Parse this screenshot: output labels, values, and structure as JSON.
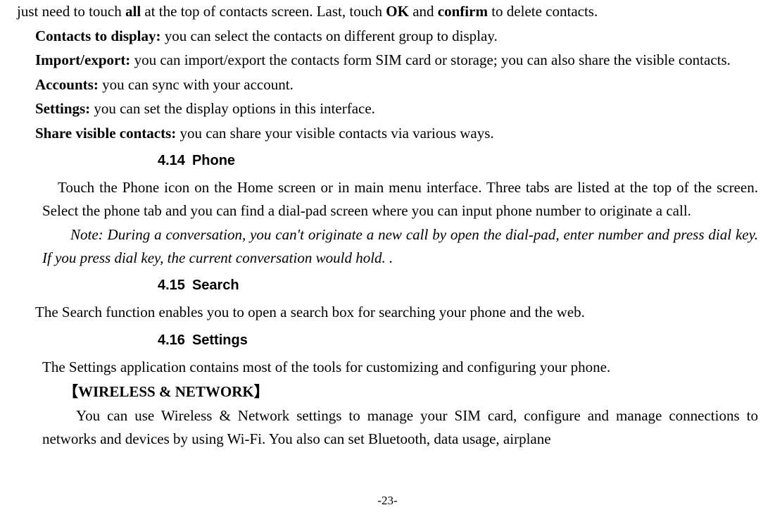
{
  "top_line": {
    "prefix": "just need to touch ",
    "b1": "all",
    "mid1": " at the top of contacts screen. Last, touch ",
    "b2": "OK",
    "mid2": " and ",
    "b3": "confirm",
    "suffix": " to delete contacts."
  },
  "items": {
    "contacts_to_display": {
      "label": "Contacts to display:",
      "text": " you can select the contacts on different group to display."
    },
    "import_export": {
      "label": "Import/export:",
      "text": " you can import/export the contacts form SIM card or storage; you can also share the visible contacts."
    },
    "accounts": {
      "label": "Accounts:",
      "text": " you can sync with your account."
    },
    "settings": {
      "label": "Settings:",
      "text": " you can set the display options in this interface."
    },
    "share_visible": {
      "label": "Share visible contacts:",
      "text": " you can share your visible contacts via various ways."
    }
  },
  "sections": {
    "phone": {
      "num": "4.14",
      "title": "Phone",
      "body": "Touch the Phone icon on the Home screen or in main menu interface. Three tabs are listed at the top of the screen. Select the phone tab and you can find a dial-pad screen where you can input phone number to originate a call.",
      "note": "Note: During a conversation, you can't originate a new call by open the dial-pad, enter number and press dial key. If you press dial key, the current conversation would hold. ."
    },
    "search": {
      "num": "4.15",
      "title": "Search",
      "body": "The Search function enables you to open a search box for searching your phone and the web."
    },
    "settings": {
      "num": "4.16",
      "title": "Settings",
      "intro": "The Settings application contains most of the tools for customizing and configuring your phone.",
      "wireless_label": "【WIRELESS & NETWORK】",
      "wireless_body": "You can use Wireless & Network settings to manage your SIM card, configure and manage connections to networks and devices by using Wi-Fi. You also can set Bluetooth, data usage, airplane"
    }
  },
  "footer": {
    "page": "-23-"
  }
}
